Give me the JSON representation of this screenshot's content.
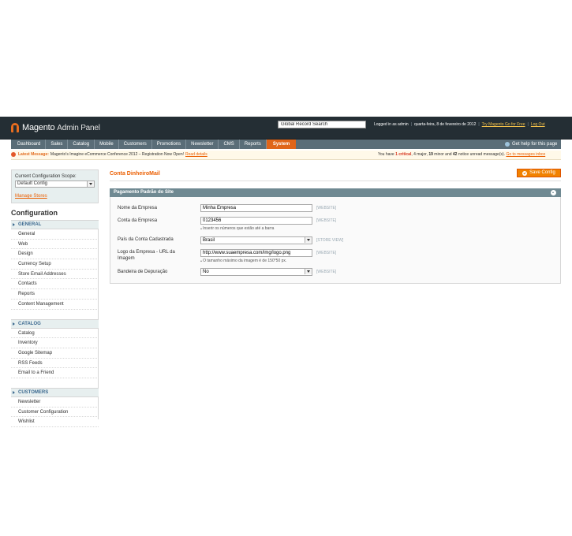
{
  "header": {
    "logo_word": "Magento",
    "logo_sub": "Admin Panel",
    "search_value": "Global Record Search",
    "logged_in": "Logged in as admin",
    "date": "quarta-feira, 8 de fevereiro de 2012",
    "try_link": "Try Magento Go for Free",
    "logout": "Log Out"
  },
  "nav": {
    "items": [
      "Dashboard",
      "Sales",
      "Catalog",
      "Mobile",
      "Customers",
      "Promotions",
      "Newsletter",
      "CMS",
      "Reports",
      "System"
    ],
    "active": "System",
    "help": "Get help for this page"
  },
  "message": {
    "label": "Latest Message:",
    "text": "Magento's Imagine eCommerce Conference 2012 – Registration Now Open!",
    "read_details": "Read details",
    "summary_pre": "You have",
    "critical": "1 critical",
    "summary_mid": ", 4 major,",
    "minor": "19",
    "summary_post": "minor and",
    "notice": "42",
    "summary_end": "notice unread message(s).",
    "inbox_link": "Go to messages inbox"
  },
  "sidebar": {
    "scope_label": "Current Configuration Scope:",
    "scope_value": "Default Config",
    "manage_stores": "Manage Stores",
    "config_title": "Configuration",
    "sections": [
      {
        "title": "General",
        "items": [
          "General",
          "Web",
          "Design",
          "Currency Setup",
          "Store Email Addresses",
          "Contacts",
          "Reports",
          "Content Management"
        ]
      },
      {
        "title": "Catalog",
        "items": [
          "Catalog",
          "Inventory",
          "Google Sitemap",
          "RSS Feeds",
          "Email to a Friend"
        ]
      },
      {
        "title": "Customers",
        "items": [
          "Newsletter",
          "Customer Configuration",
          "Wishlist"
        ]
      }
    ]
  },
  "main": {
    "title": "Conta DinheiroMail",
    "save_label": "Save Config",
    "fieldset_title": "Pagamento Padrão do Site",
    "fields": [
      {
        "label": "Nome da Empresa",
        "value": "Minha Empresa",
        "scope": "[WEBSITE]",
        "note": ""
      },
      {
        "label": "Conta da Empresa",
        "value": "0123456",
        "scope": "[WEBSITE]",
        "note": "Inserir os números que estão até a barra"
      },
      {
        "label": "País da Conta Cadastrada",
        "value": "Brasil",
        "scope": "[STORE VIEW]",
        "note": ""
      },
      {
        "label": "Logo da Empresa - URL da Imagem",
        "value": "http://www.suaempresa.com/img/logo.png",
        "scope": "[WEBSITE]",
        "note": "O tamanho máximo da imagem é de 150*50 px."
      },
      {
        "label": "Bandeira de Depuração",
        "value": "No",
        "scope": "[WEBSITE]",
        "note": ""
      }
    ]
  },
  "colors": {
    "header_bg": "#242e34",
    "nav_bg": "#5a6d78",
    "accent": "#eb5e00",
    "fieldset_head": "#6f8992"
  }
}
